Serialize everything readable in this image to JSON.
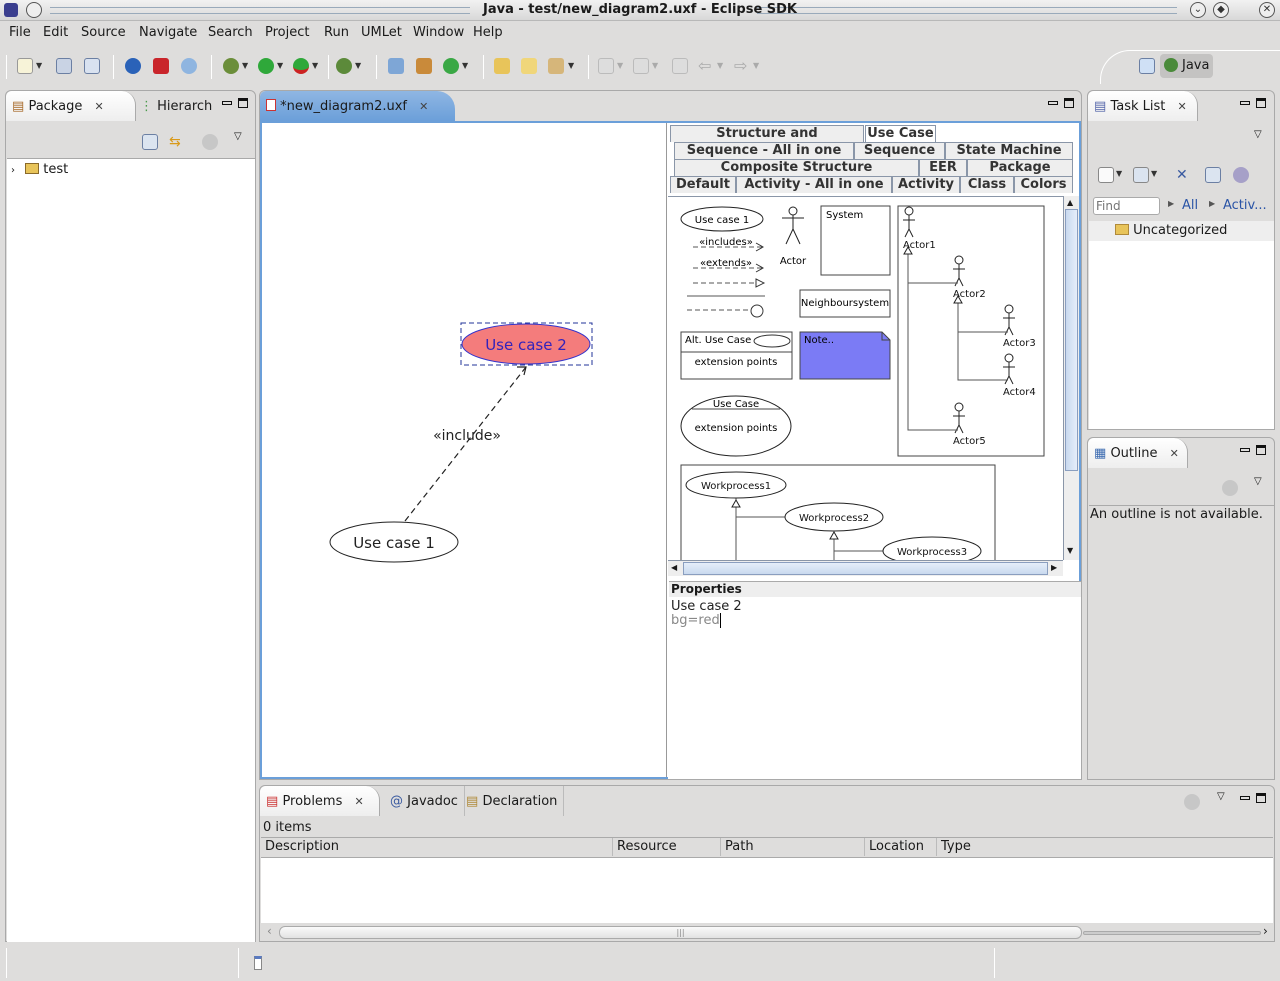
{
  "window": {
    "title": "Java - test/new_diagram2.uxf - Eclipse SDK",
    "controls": [
      "minimize-icon",
      "maximize-icon",
      "close-icon"
    ]
  },
  "menu": [
    "File",
    "Edit",
    "Source",
    "Navigate",
    "Search",
    "Project",
    "Run",
    "UMLet",
    "Window",
    "Help"
  ],
  "perspective": {
    "label": "Java"
  },
  "package_explorer": {
    "tabs": [
      {
        "label": "Package",
        "active": true
      },
      {
        "label": "Hierarch",
        "active": false
      }
    ],
    "tree": [
      {
        "label": "test",
        "expanded": false,
        "icon": "project-folder-icon"
      }
    ]
  },
  "editor": {
    "tab_label": "*new_diagram2.uxf",
    "diagram": {
      "elements": [
        {
          "type": "use-case",
          "label": "Use case 1",
          "bg": "#ffffff",
          "selected": false
        },
        {
          "type": "use-case",
          "label": "Use case 2",
          "bg": "#f47c7c",
          "selected": true
        },
        {
          "type": "relation",
          "label": "«include»",
          "from": "Use case 1",
          "to": "Use case 2"
        }
      ]
    },
    "palette_tabs": {
      "rows": [
        [
          "Structure and Deployment",
          "Use Case"
        ],
        [
          "Sequence - All in one",
          "Sequence",
          "State Machine"
        ],
        [
          "Composite Structure",
          "EER",
          "Package"
        ],
        [
          "Default",
          "Activity - All in one",
          "Activity",
          "Class",
          "Colors"
        ]
      ],
      "selected": "Use Case"
    },
    "palette_items": {
      "use_case_1": "Use case 1",
      "includes": "«includes»",
      "extends": "«extends»",
      "actor": "Actor",
      "system": "System",
      "neighbour": "Neighboursystem",
      "alt_use_case": "Alt. Use Case",
      "extension_points": "extension points",
      "note": "Note..",
      "use_case_box": "Use Case",
      "actors": [
        "Actor1",
        "Actor2",
        "Actor3",
        "Actor4",
        "Actor5"
      ],
      "workprocesses": [
        "Workprocess1",
        "Workprocess2",
        "Workprocess3"
      ]
    },
    "properties": {
      "header": "Properties",
      "lines": [
        "Use case 2",
        "bg=red"
      ]
    }
  },
  "task_list": {
    "tab_label": "Task List",
    "find_placeholder": "Find",
    "filters": [
      "All",
      "Activ..."
    ],
    "items": [
      "Uncategorized"
    ]
  },
  "outline": {
    "tab_label": "Outline",
    "message": "An outline is not available."
  },
  "problems": {
    "tabs": [
      {
        "label": "Problems",
        "active": true
      },
      {
        "label": "Javadoc"
      },
      {
        "label": "Declaration"
      }
    ],
    "count": "0 items",
    "columns": [
      "Description",
      "Resource",
      "Path",
      "Location",
      "Type"
    ]
  }
}
